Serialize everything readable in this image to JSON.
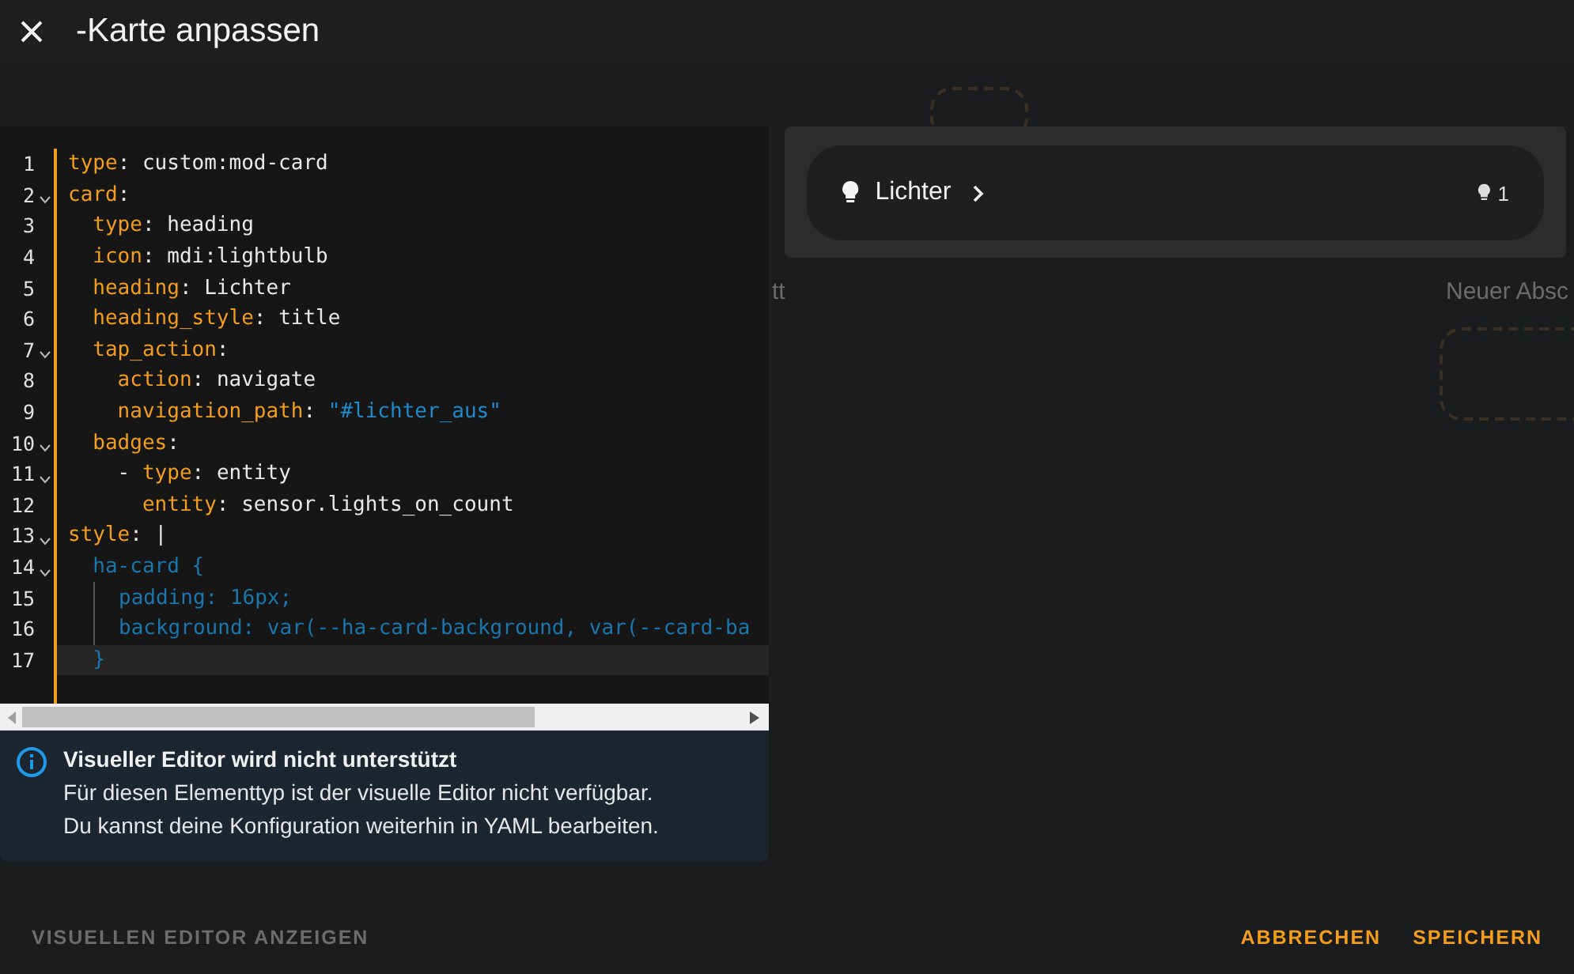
{
  "dialog": {
    "title": "-Karte anpassen"
  },
  "backdrop": {
    "texts": [
      "tt",
      "Neuer Absc"
    ]
  },
  "editor": {
    "lines": [
      {
        "number": "1",
        "foldable": false,
        "active": false,
        "guide": false,
        "tokens": [
          {
            "kind": "key",
            "text": "type"
          },
          {
            "kind": "punct",
            "text": ": "
          },
          {
            "kind": "value",
            "text": "custom:mod-card"
          }
        ]
      },
      {
        "number": "2",
        "foldable": true,
        "active": false,
        "guide": false,
        "tokens": [
          {
            "kind": "key",
            "text": "card"
          },
          {
            "kind": "punct",
            "text": ":"
          }
        ]
      },
      {
        "number": "3",
        "foldable": false,
        "active": false,
        "guide": false,
        "tokens": [
          {
            "kind": "key",
            "text": "  type"
          },
          {
            "kind": "punct",
            "text": ": "
          },
          {
            "kind": "value",
            "text": "heading"
          }
        ]
      },
      {
        "number": "4",
        "foldable": false,
        "active": false,
        "guide": false,
        "tokens": [
          {
            "kind": "key",
            "text": "  icon"
          },
          {
            "kind": "punct",
            "text": ": "
          },
          {
            "kind": "value",
            "text": "mdi:lightbulb"
          }
        ]
      },
      {
        "number": "5",
        "foldable": false,
        "active": false,
        "guide": false,
        "tokens": [
          {
            "kind": "key",
            "text": "  heading"
          },
          {
            "kind": "punct",
            "text": ": "
          },
          {
            "kind": "value",
            "text": "Lichter"
          }
        ]
      },
      {
        "number": "6",
        "foldable": false,
        "active": false,
        "guide": false,
        "tokens": [
          {
            "kind": "key",
            "text": "  heading_style"
          },
          {
            "kind": "punct",
            "text": ": "
          },
          {
            "kind": "value",
            "text": "title"
          }
        ]
      },
      {
        "number": "7",
        "foldable": true,
        "active": false,
        "guide": false,
        "tokens": [
          {
            "kind": "key",
            "text": "  tap_action"
          },
          {
            "kind": "punct",
            "text": ":"
          }
        ]
      },
      {
        "number": "8",
        "foldable": false,
        "active": false,
        "guide": false,
        "tokens": [
          {
            "kind": "key",
            "text": "    action"
          },
          {
            "kind": "punct",
            "text": ": "
          },
          {
            "kind": "value",
            "text": "navigate"
          }
        ]
      },
      {
        "number": "9",
        "foldable": false,
        "active": false,
        "guide": false,
        "tokens": [
          {
            "kind": "key",
            "text": "    navigation_path"
          },
          {
            "kind": "punct",
            "text": ": "
          },
          {
            "kind": "string",
            "text": "\"#lichter_aus\""
          }
        ]
      },
      {
        "number": "10",
        "foldable": true,
        "active": false,
        "guide": false,
        "tokens": [
          {
            "kind": "key",
            "text": "  badges"
          },
          {
            "kind": "punct",
            "text": ":"
          }
        ]
      },
      {
        "number": "11",
        "foldable": true,
        "active": false,
        "guide": false,
        "tokens": [
          {
            "kind": "punct",
            "text": "    - "
          },
          {
            "kind": "key",
            "text": "type"
          },
          {
            "kind": "punct",
            "text": ": "
          },
          {
            "kind": "value",
            "text": "entity"
          }
        ]
      },
      {
        "number": "12",
        "foldable": false,
        "active": false,
        "guide": false,
        "tokens": [
          {
            "kind": "key",
            "text": "      entity"
          },
          {
            "kind": "punct",
            "text": ": "
          },
          {
            "kind": "value",
            "text": "sensor.lights_on_count"
          }
        ]
      },
      {
        "number": "13",
        "foldable": true,
        "active": false,
        "guide": false,
        "tokens": [
          {
            "kind": "key",
            "text": "style"
          },
          {
            "kind": "punct",
            "text": ": |"
          }
        ]
      },
      {
        "number": "14",
        "foldable": true,
        "active": false,
        "guide": false,
        "tokens": [
          {
            "kind": "css",
            "text": "  ha-card {"
          }
        ]
      },
      {
        "number": "15",
        "foldable": false,
        "active": false,
        "guide": true,
        "tokens": [
          {
            "kind": "css",
            "text": "padding: 16px;"
          }
        ]
      },
      {
        "number": "16",
        "foldable": false,
        "active": false,
        "guide": true,
        "tokens": [
          {
            "kind": "css",
            "text": "background: var(--ha-card-background, var(--card-ba"
          }
        ]
      },
      {
        "number": "17",
        "foldable": false,
        "active": true,
        "guide": false,
        "tokens": [
          {
            "kind": "css",
            "text": "  }"
          }
        ]
      }
    ]
  },
  "notice": {
    "title": "Visueller Editor wird nicht unterstützt",
    "lines": [
      "Für diesen Elementtyp ist der visuelle Editor nicht verfügbar.",
      "Du kannst deine Konfiguration weiterhin in YAML bearbeiten."
    ]
  },
  "preview": {
    "heading": "Lichter",
    "badge": "1"
  },
  "footer": {
    "left": "VISUELLEN EDITOR ANZEIGEN",
    "buttons": [
      "ABBRECHEN",
      "SPEICHERN"
    ]
  }
}
